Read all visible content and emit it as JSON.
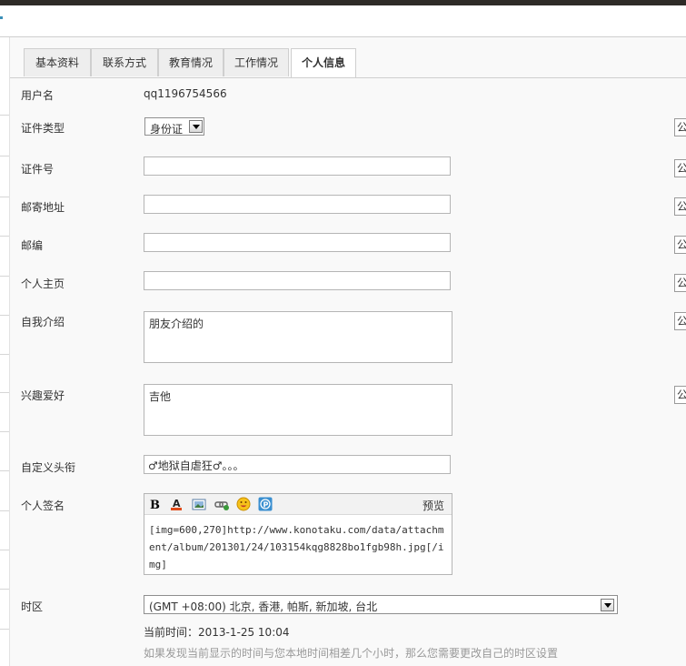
{
  "tabs": [
    {
      "label": "基本资料"
    },
    {
      "label": "联系方式"
    },
    {
      "label": "教育情况"
    },
    {
      "label": "工作情况"
    },
    {
      "label": "个人信息"
    }
  ],
  "fields": {
    "username": {
      "label": "用户名",
      "value": "qq1196754566"
    },
    "id_type": {
      "label": "证件类型",
      "selected": "身份证"
    },
    "id_number": {
      "label": "证件号",
      "value": ""
    },
    "address": {
      "label": "邮寄地址",
      "value": ""
    },
    "zipcode": {
      "label": "邮编",
      "value": ""
    },
    "homepage": {
      "label": "个人主页",
      "value": ""
    },
    "bio": {
      "label": "自我介绍",
      "value": "朋友介绍的"
    },
    "interests": {
      "label": "兴趣爱好",
      "value": "吉他"
    },
    "custom_title": {
      "label": "自定义头衔",
      "value": "♂地狱自虐狂♂。。。"
    },
    "signature": {
      "label": "个人签名",
      "preview_label": "预览",
      "value": "[img=600,270]http://www.konotaku.com/data/attachment/album/201301/24/103154kqg8828bo1fgb98h.jpg[/img]"
    },
    "timezone": {
      "label": "时区",
      "selected": "(GMT +08:00) 北京, 香港, 帕斯, 新加坡, 台北",
      "current_time": "当前时间：2013-1-25 10:04",
      "hint": "如果发现当前显示的时间与您本地时间相差几个小时，那么您需要更改自己的时区设置"
    }
  },
  "privacy_glyph": "公",
  "icons": [
    "bold-icon",
    "font-color-icon",
    "image-icon",
    "link-icon",
    "smiley-icon",
    "p-icon"
  ],
  "colors": {
    "accent": "#3a8fb7",
    "border": "#b5b5b5",
    "hint": "#999999"
  }
}
